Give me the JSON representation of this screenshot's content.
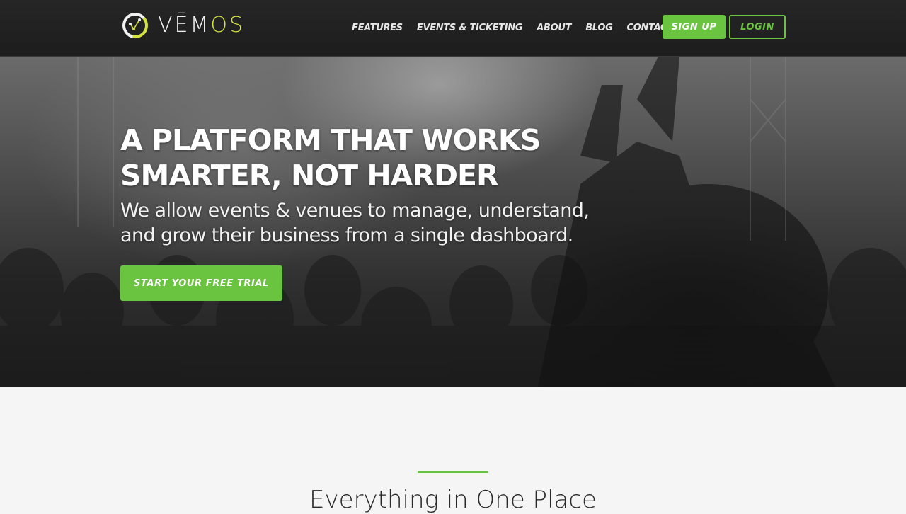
{
  "brand": {
    "name_part1": "VĒM",
    "name_part2": "OS",
    "accent_color": "#6ac43f",
    "logo_color": "#d4e23c"
  },
  "nav": {
    "items": [
      "FEATURES",
      "EVENTS & TICKETING",
      "ABOUT",
      "BLOG",
      "CONTACT"
    ]
  },
  "auth": {
    "signup_label": "SIGN UP",
    "login_label": "LOGIN"
  },
  "hero": {
    "title_line1": "A PLATFORM THAT WORKS",
    "title_line2": "SMARTER, NOT HARDER",
    "subtitle_line1": "We allow events & venues to manage, understand,",
    "subtitle_line2": "and grow their business from a single dashboard.",
    "cta_label": "START YOUR FREE TRIAL"
  },
  "section": {
    "title": "Everything in One Place"
  }
}
